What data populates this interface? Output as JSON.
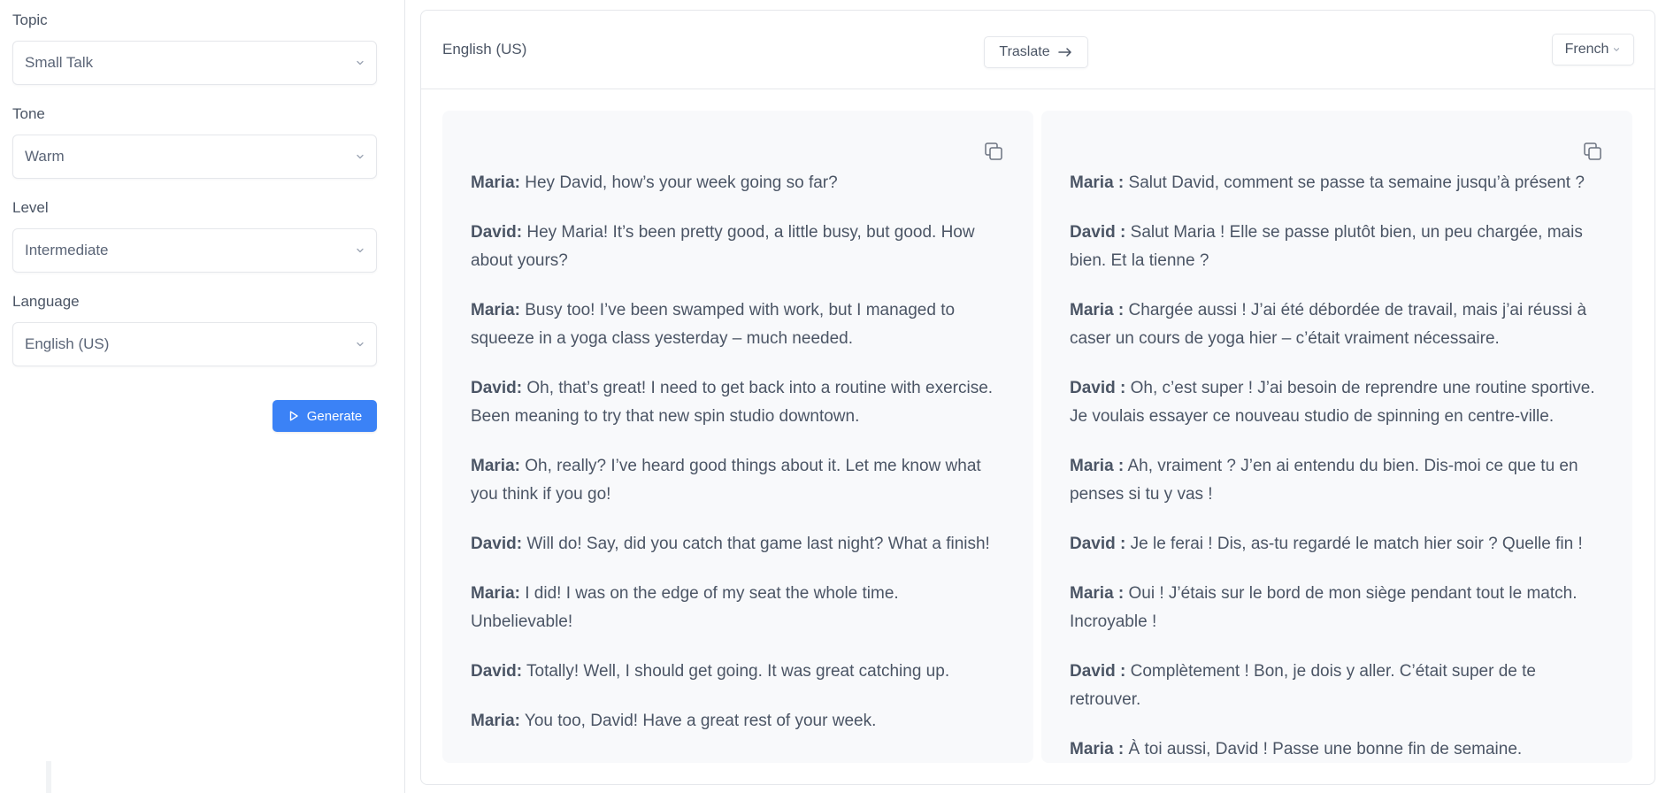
{
  "sidebar": {
    "fields": [
      {
        "label": "Topic",
        "value": "Small Talk"
      },
      {
        "label": "Tone",
        "value": "Warm"
      },
      {
        "label": "Level",
        "value": "Intermediate"
      },
      {
        "label": "Language",
        "value": "English (US)"
      }
    ],
    "generate_label": "Generate"
  },
  "header": {
    "source_language": "English (US)",
    "translate_label": "Traslate",
    "target_language": "French"
  },
  "source_lines": [
    {
      "speaker": "Maria:",
      "text": "Hey David, how’s your week going so far?"
    },
    {
      "speaker": "David:",
      "text": "Hey Maria! It’s been pretty good, a little busy, but good. How about yours?"
    },
    {
      "speaker": "Maria:",
      "text": "Busy too! I’ve been swamped with work, but I managed to squeeze in a yoga class yesterday – much needed."
    },
    {
      "speaker": "David:",
      "text": "Oh, that’s great! I need to get back into a routine with exercise. Been meaning to try that new spin studio downtown."
    },
    {
      "speaker": "Maria:",
      "text": "Oh, really? I’ve heard good things about it. Let me know what you think if you go!"
    },
    {
      "speaker": "David:",
      "text": "Will do! Say, did you catch that game last night? What a finish!"
    },
    {
      "speaker": "Maria:",
      "text": "I did! I was on the edge of my seat the whole time. Unbelievable!"
    },
    {
      "speaker": "David:",
      "text": "Totally! Well, I should get going. It was great catching up."
    },
    {
      "speaker": "Maria:",
      "text": "You too, David! Have a great rest of your week."
    }
  ],
  "target_lines": [
    {
      "speaker": "Maria :",
      "text": "Salut David, comment se passe ta semaine jusqu’à présent ?"
    },
    {
      "speaker": "David :",
      "text": "Salut Maria ! Elle se passe plutôt bien, un peu chargée, mais bien. Et la tienne ?"
    },
    {
      "speaker": "Maria :",
      "text": "Chargée aussi ! J’ai été débordée de travail, mais j’ai réussi à caser un cours de yoga hier – c’était vraiment nécessaire."
    },
    {
      "speaker": "David :",
      "text": "Oh, c’est super ! J’ai besoin de reprendre une routine sportive. Je voulais essayer ce nouveau studio de spinning en centre-ville."
    },
    {
      "speaker": "Maria :",
      "text": "Ah, vraiment ? J’en ai entendu du bien. Dis-moi ce que tu en penses si tu y vas !"
    },
    {
      "speaker": "David :",
      "text": "Je le ferai ! Dis, as-tu regardé le match hier soir ? Quelle fin !"
    },
    {
      "speaker": "Maria :",
      "text": "Oui ! J’étais sur le bord de mon siège pendant tout le match. Incroyable !"
    },
    {
      "speaker": "David :",
      "text": "Complètement ! Bon, je dois y aller. C’était super de te retrouver."
    },
    {
      "speaker": "Maria :",
      "text": "À toi aussi, David ! Passe une bonne fin de semaine."
    }
  ],
  "colors": {
    "accent": "#3b82f6",
    "text": "#4b5565",
    "border": "#e5e7eb",
    "pane_bg": "#f8f9fb"
  },
  "icons": {
    "select_chevron": "chevron-down-icon",
    "generate": "play-icon",
    "translate": "arrow-right-icon",
    "copy": "copy-icon"
  }
}
